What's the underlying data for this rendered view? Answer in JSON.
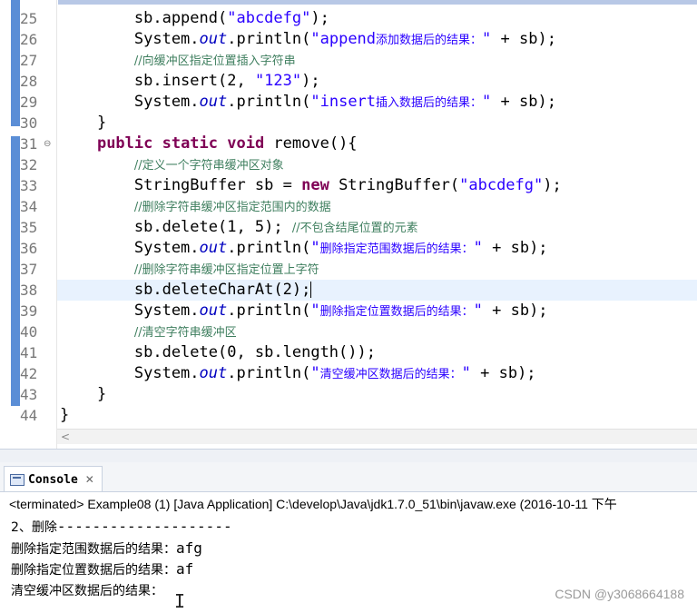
{
  "editor": {
    "lines": [
      {
        "no": "25",
        "tokens": [
          {
            "t": "        sb.append(",
            "c": ""
          },
          {
            "t": "\"abcdefg\"",
            "c": "str"
          },
          {
            "t": ");",
            "c": ""
          }
        ]
      },
      {
        "no": "26",
        "tokens": [
          {
            "t": "        System.",
            "c": ""
          },
          {
            "t": "out",
            "c": "fld"
          },
          {
            "t": ".println(",
            "c": ""
          },
          {
            "t": "\"append",
            "c": "str"
          },
          {
            "t": "添加数据后的结果：",
            "c": "str zh"
          },
          {
            "t": "\"",
            "c": "str"
          },
          {
            "t": " + sb);",
            "c": ""
          }
        ]
      },
      {
        "no": "27",
        "tokens": [
          {
            "t": "        ",
            "c": ""
          },
          {
            "t": "//向缓冲区指定位置插入字符串",
            "c": "cmt"
          }
        ]
      },
      {
        "no": "28",
        "tokens": [
          {
            "t": "        sb.insert(2, ",
            "c": ""
          },
          {
            "t": "\"123\"",
            "c": "str"
          },
          {
            "t": ");",
            "c": ""
          }
        ]
      },
      {
        "no": "29",
        "tokens": [
          {
            "t": "        System.",
            "c": ""
          },
          {
            "t": "out",
            "c": "fld"
          },
          {
            "t": ".println(",
            "c": ""
          },
          {
            "t": "\"insert",
            "c": "str"
          },
          {
            "t": "插入数据后的结果：",
            "c": "str zh"
          },
          {
            "t": "\"",
            "c": "str"
          },
          {
            "t": " + sb);",
            "c": ""
          }
        ]
      },
      {
        "no": "30",
        "tokens": [
          {
            "t": "    }",
            "c": ""
          }
        ]
      },
      {
        "no": "31",
        "fold": true,
        "tokens": [
          {
            "t": "    ",
            "c": ""
          },
          {
            "t": "public static void",
            "c": "kw"
          },
          {
            "t": " remove(){",
            "c": ""
          }
        ]
      },
      {
        "no": "32",
        "tokens": [
          {
            "t": "        ",
            "c": ""
          },
          {
            "t": "//定义一个字符串缓冲区对象",
            "c": "cmt"
          }
        ]
      },
      {
        "no": "33",
        "tokens": [
          {
            "t": "        StringBuffer sb = ",
            "c": ""
          },
          {
            "t": "new",
            "c": "kw"
          },
          {
            "t": " StringBuffer(",
            "c": ""
          },
          {
            "t": "\"abcdefg\"",
            "c": "str"
          },
          {
            "t": ");",
            "c": ""
          }
        ]
      },
      {
        "no": "34",
        "tokens": [
          {
            "t": "        ",
            "c": ""
          },
          {
            "t": "//删除字符串缓冲区指定范围内的数据",
            "c": "cmt"
          }
        ]
      },
      {
        "no": "35",
        "tokens": [
          {
            "t": "        sb.delete(1, 5); ",
            "c": ""
          },
          {
            "t": "//不包含结尾位置的元素",
            "c": "cmt"
          }
        ]
      },
      {
        "no": "36",
        "tokens": [
          {
            "t": "        System.",
            "c": ""
          },
          {
            "t": "out",
            "c": "fld"
          },
          {
            "t": ".println(",
            "c": ""
          },
          {
            "t": "\"",
            "c": "str"
          },
          {
            "t": "删除指定范围数据后的结果：",
            "c": "str zh"
          },
          {
            "t": "\"",
            "c": "str"
          },
          {
            "t": " + sb);",
            "c": ""
          }
        ]
      },
      {
        "no": "37",
        "tokens": [
          {
            "t": "        ",
            "c": ""
          },
          {
            "t": "//删除字符串缓冲区指定位置上字符",
            "c": "cmt"
          }
        ]
      },
      {
        "no": "38",
        "current": true,
        "tokens": [
          {
            "t": "        sb.deleteCharAt(2);",
            "c": ""
          }
        ]
      },
      {
        "no": "39",
        "tokens": [
          {
            "t": "        System.",
            "c": ""
          },
          {
            "t": "out",
            "c": "fld"
          },
          {
            "t": ".println(",
            "c": ""
          },
          {
            "t": "\"",
            "c": "str"
          },
          {
            "t": "删除指定位置数据后的结果：",
            "c": "str zh"
          },
          {
            "t": "\"",
            "c": "str"
          },
          {
            "t": " + sb);",
            "c": ""
          }
        ]
      },
      {
        "no": "40",
        "tokens": [
          {
            "t": "        ",
            "c": ""
          },
          {
            "t": "//清空字符串缓冲区",
            "c": "cmt"
          }
        ]
      },
      {
        "no": "41",
        "tokens": [
          {
            "t": "        sb.delete(0, sb.length());",
            "c": ""
          }
        ]
      },
      {
        "no": "42",
        "tokens": [
          {
            "t": "        System.",
            "c": ""
          },
          {
            "t": "out",
            "c": "fld"
          },
          {
            "t": ".println(",
            "c": ""
          },
          {
            "t": "\"",
            "c": "str"
          },
          {
            "t": "清空缓冲区数据后的结果：",
            "c": "str zh"
          },
          {
            "t": "\"",
            "c": "str"
          },
          {
            "t": " + sb);",
            "c": ""
          }
        ]
      },
      {
        "no": "43",
        "tokens": [
          {
            "t": "    }",
            "c": ""
          }
        ]
      },
      {
        "no": "44",
        "tokens": [
          {
            "t": "}",
            "c": ""
          }
        ]
      }
    ],
    "scroll_left": "<"
  },
  "console": {
    "tab_label": "Console",
    "close": "✕",
    "status": "<terminated> Example08 (1) [Java Application] C:\\develop\\Java\\jdk1.7.0_51\\bin\\javaw.exe (2016-10-11 下午",
    "output": [
      {
        "label": "2、删除",
        "mono": "--------------------"
      },
      {
        "label": "删除指定范围数据后的结果：",
        "mono": "afg"
      },
      {
        "label": "删除指定位置数据后的结果：",
        "mono": "af"
      },
      {
        "label": "清空缓冲区数据后的结果：",
        "mono": ""
      }
    ],
    "cursor": "I"
  },
  "watermark": "CSDN @y3068664188"
}
